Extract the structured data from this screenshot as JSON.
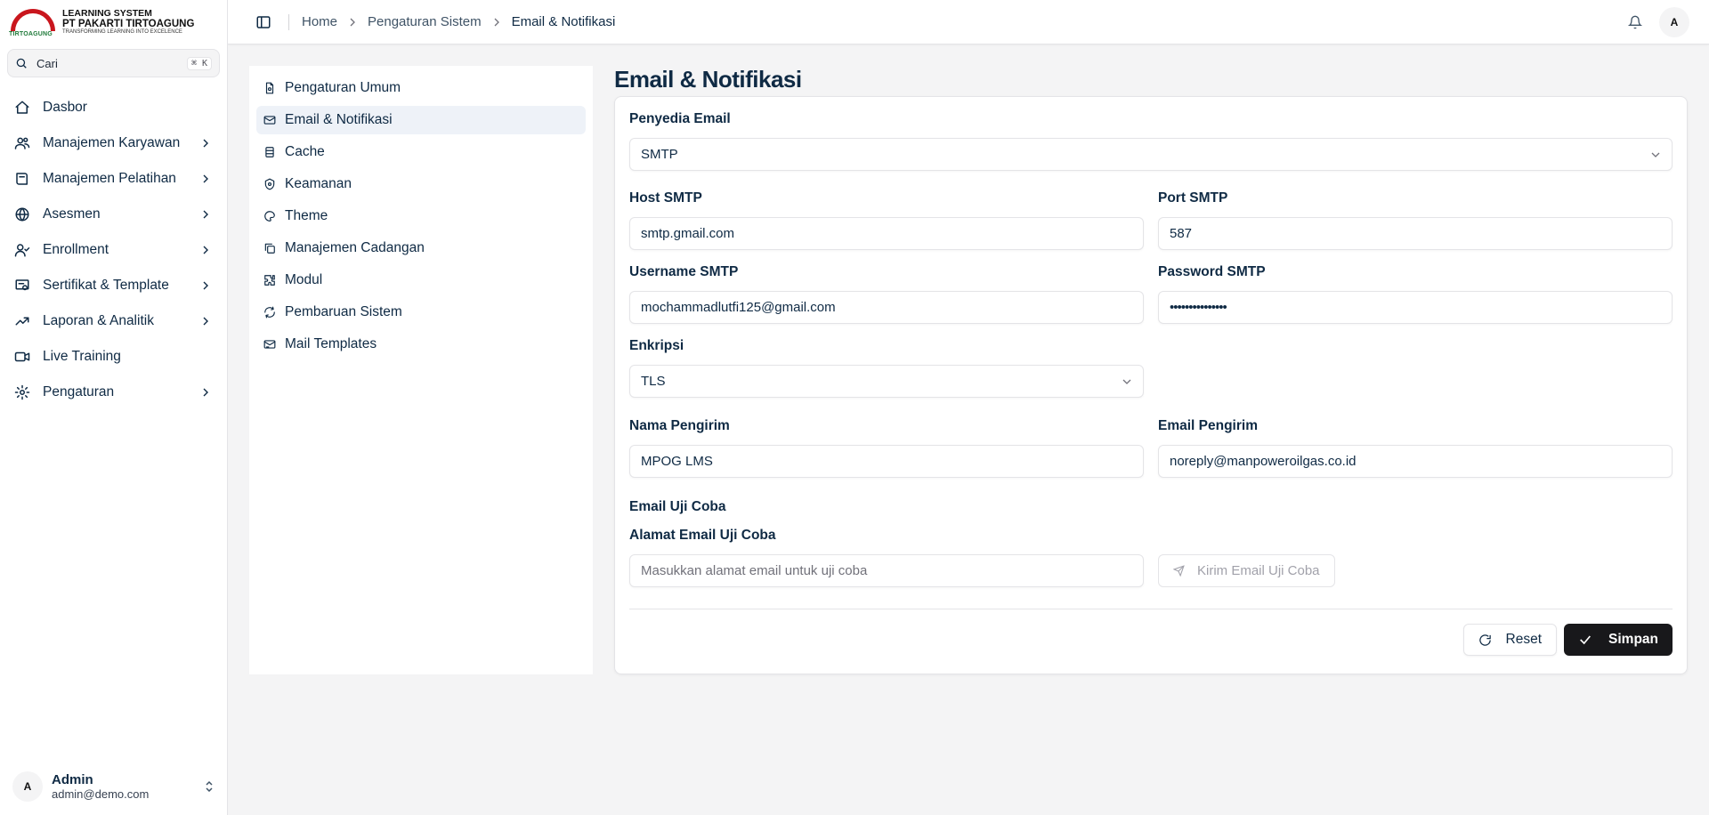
{
  "logo": {
    "mark_text": "TIRTOAGUNG",
    "line1": "LEARNING SYSTEM",
    "line2": "PT PAKARTI TIRTOAGUNG",
    "line3": "TRANSFORMING LEARNING INTO EXCELENCE"
  },
  "search": {
    "label": "Cari",
    "shortcut": "⌘ K",
    "icon": "search-icon"
  },
  "sidebar": {
    "items": [
      {
        "label": "Dasbor",
        "icon": "home-icon",
        "has_children": false
      },
      {
        "label": "Manajemen Karyawan",
        "icon": "users-icon",
        "has_children": true
      },
      {
        "label": "Manajemen Pelatihan",
        "icon": "book-icon",
        "has_children": true
      },
      {
        "label": "Asesmen",
        "icon": "award-icon",
        "has_children": true
      },
      {
        "label": "Enrollment",
        "icon": "user-check-icon",
        "has_children": true
      },
      {
        "label": "Sertifikat & Template",
        "icon": "certificate-icon",
        "has_children": true
      },
      {
        "label": "Laporan & Analitik",
        "icon": "chart-icon",
        "has_children": true
      },
      {
        "label": "Live Training",
        "icon": "video-icon",
        "has_children": false
      },
      {
        "label": "Pengaturan",
        "icon": "gear-icon",
        "has_children": true
      }
    ]
  },
  "user": {
    "initial": "A",
    "name": "Admin",
    "email": "admin@demo.com"
  },
  "topbar": {
    "breadcrumbs": [
      "Home",
      "Pengaturan Sistem",
      "Email & Notifikasi"
    ],
    "avatar_initial": "A"
  },
  "settings_nav": {
    "items": [
      {
        "label": "Pengaturan Umum",
        "icon": "file-settings-icon",
        "active": false
      },
      {
        "label": "Email & Notifikasi",
        "icon": "mail-icon",
        "active": true
      },
      {
        "label": "Cache",
        "icon": "database-icon",
        "active": false
      },
      {
        "label": "Keamanan",
        "icon": "shield-icon",
        "active": false
      },
      {
        "label": "Theme",
        "icon": "palette-icon",
        "active": false
      },
      {
        "label": "Manajemen Cadangan",
        "icon": "copy-icon",
        "active": false
      },
      {
        "label": "Modul",
        "icon": "puzzle-icon",
        "active": false
      },
      {
        "label": "Pembaruan Sistem",
        "icon": "refresh-icon",
        "active": false
      },
      {
        "label": "Mail Templates",
        "icon": "mail-template-icon",
        "active": false
      }
    ]
  },
  "panel": {
    "title": "Email & Notifikasi",
    "provider": {
      "label": "Penyedia Email",
      "value": "SMTP"
    },
    "host": {
      "label": "Host SMTP",
      "value": "smtp.gmail.com"
    },
    "port": {
      "label": "Port SMTP",
      "value": "587"
    },
    "username": {
      "label": "Username SMTP",
      "value": "mochammadlutfi125@gmail.com"
    },
    "password": {
      "label": "Password SMTP",
      "value": "•••••••••••••••"
    },
    "encryption": {
      "label": "Enkripsi",
      "value": "TLS"
    },
    "sender_name": {
      "label": "Nama Pengirim",
      "value": "MPOG LMS"
    },
    "sender_email": {
      "label": "Email Pengirim",
      "value": "noreply@manpoweroilgas.co.id"
    },
    "test": {
      "section_label": "Email Uji Coba",
      "field_label": "Alamat Email Uji Coba",
      "placeholder": "Masukkan alamat email untuk uji coba",
      "button_label": "Kirim Email Uji Coba"
    },
    "reset_label": "Reset",
    "save_label": "Simpan"
  }
}
